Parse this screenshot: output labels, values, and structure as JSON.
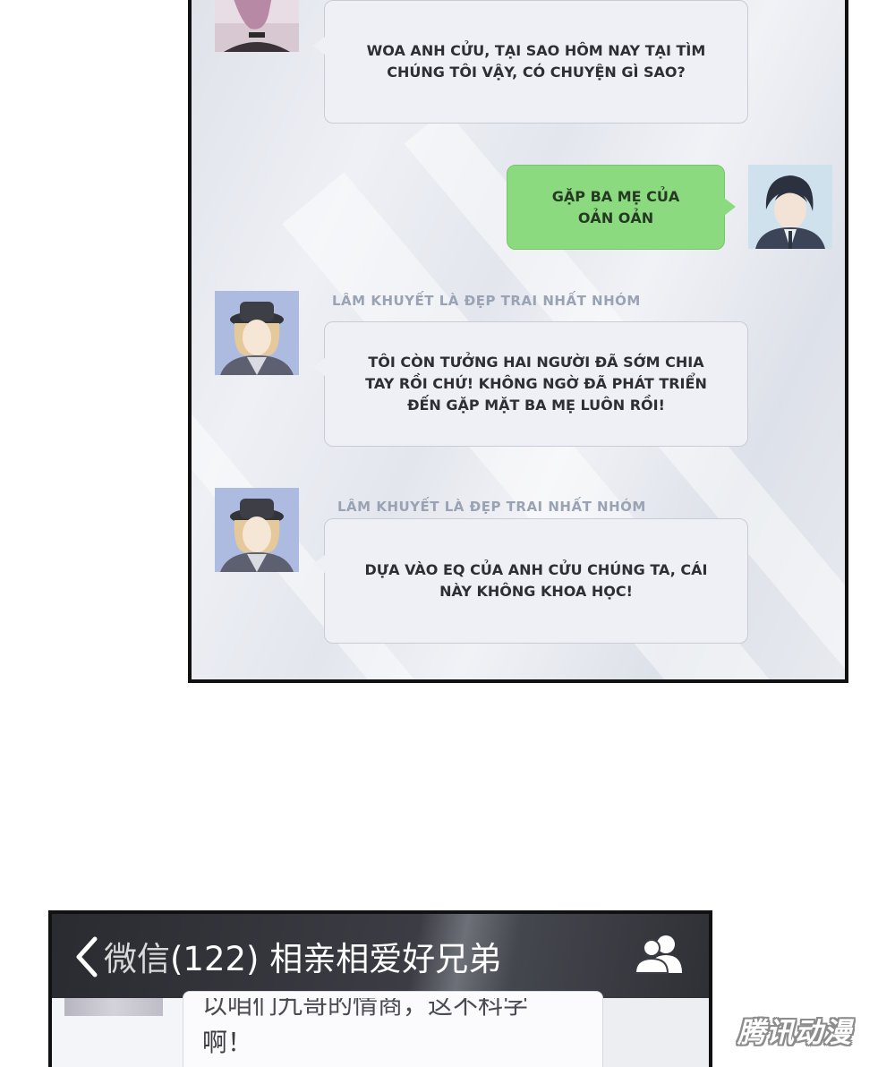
{
  "panel1": {
    "messages": [
      {
        "side": "left",
        "avatar": "avatar-purple-hair",
        "sender": "",
        "text": "WOA ANH CỬU, TẠI SAO HÔM NAY TẠI TÌM CHÚNG TÔI VẬY, CÓ CHUYỆN GÌ SAO?"
      },
      {
        "side": "right",
        "avatar": "avatar-dark-hair-suit",
        "sender": "",
        "text": "GẶP BA MẸ CỦA OẢN OẢN"
      },
      {
        "side": "left",
        "avatar": "avatar-blond-hat",
        "sender": "LÂM KHUYẾT LÀ ĐẸP TRAI NHẤT NHÓM",
        "text": "TÔI CÒN TƯỞNG HAI NGƯỜI ĐÃ SỚM CHIA TAY RỒI CHỨ! KHÔNG NGỜ ĐÃ PHÁT TRIỂN ĐẾN GẶP MẶT BA MẸ LUÔN RỒI!"
      },
      {
        "side": "left",
        "avatar": "avatar-blond-hat",
        "sender": "LÂM KHUYẾT LÀ ĐẸP TRAI NHẤT NHÓM",
        "text": "DỰA VÀO EQ CỦA ANH CỬU CHÚNG TA, CÁI NÀY KHÔNG KHOA HỌC!"
      }
    ],
    "colors": {
      "outgoing_bubble": "#8cda7f",
      "incoming_bubble": "#eef0f6",
      "sender_name": "#9aa3b3"
    }
  },
  "panel2": {
    "back_label": "微信",
    "unread_count": "(122)",
    "chat_title": "相亲相爱好兄弟",
    "message_line1": "以咱们九哥的情商，这不科学",
    "message_line2": "啊！",
    "icons": {
      "back": "chevron-left-icon",
      "members": "group-members-icon"
    }
  },
  "watermark": "腾讯动漫"
}
